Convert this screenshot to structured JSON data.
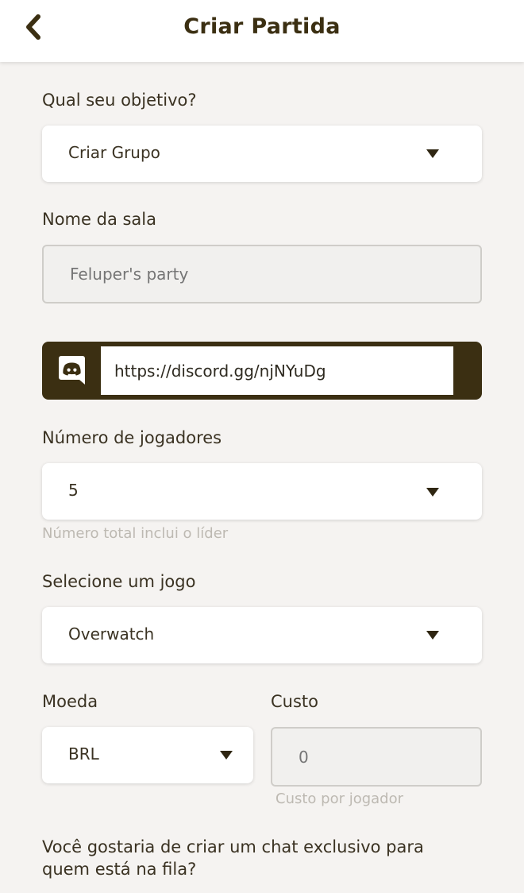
{
  "header": {
    "title": "Criar Partida",
    "back_icon": "chevron-left-icon"
  },
  "form": {
    "objective": {
      "label": "Qual seu objetivo?",
      "value": "Criar Grupo"
    },
    "room_name": {
      "label": "Nome da sala",
      "placeholder": "Feluper's party"
    },
    "discord": {
      "icon": "discord-icon",
      "value": "https://discord.gg/njNYuDg"
    },
    "players": {
      "label": "Número de jogadores",
      "value": "5",
      "hint": "Número total inclui o líder"
    },
    "game": {
      "label": "Selecione um jogo",
      "value": "Overwatch"
    },
    "currency": {
      "label": "Moeda",
      "value": "BRL"
    },
    "cost": {
      "label": "Custo",
      "placeholder": "0",
      "hint": "Custo por jogador"
    },
    "chat_question": "Você gostaria de criar um chat exclusivo para quem está na fila?"
  },
  "colors": {
    "brand_dark": "#3b2f12",
    "background": "#f5f3f1"
  }
}
